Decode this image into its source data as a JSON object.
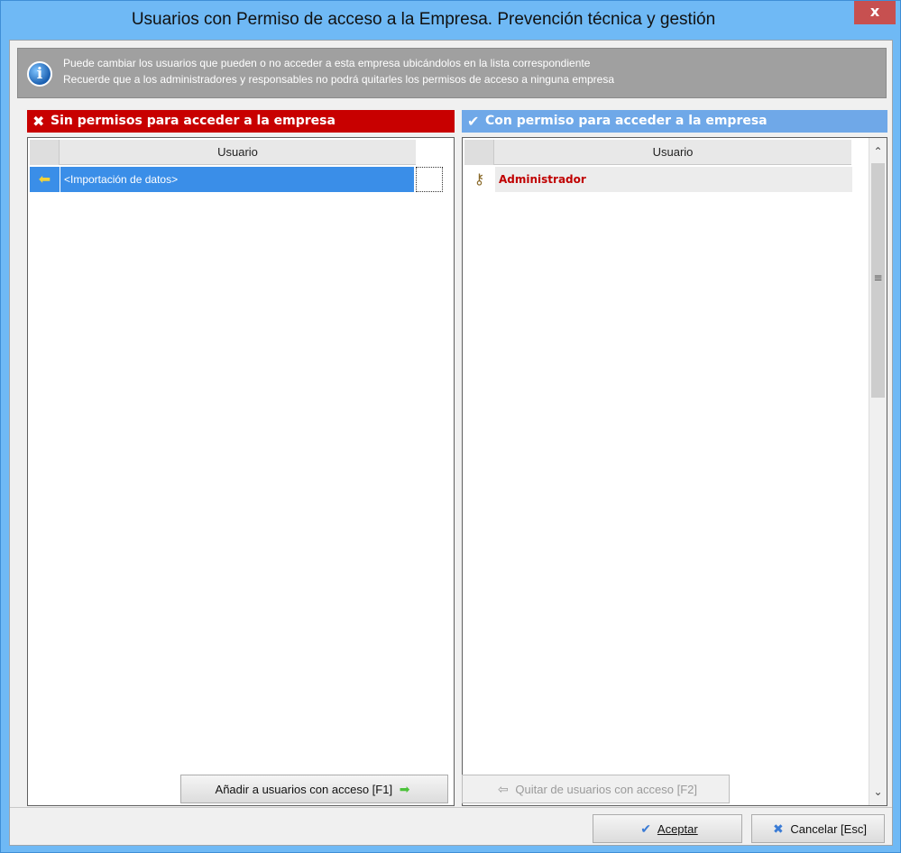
{
  "window": {
    "title": "Usuarios con Permiso de acceso a la Empresa. Prevención técnica y gestión",
    "close_label": "x"
  },
  "info": {
    "line1": "Puede cambiar los usuarios que pueden o no acceder a esta empresa ubicándolos en la lista correspondiente",
    "line2": "Recuerde que a los administradores y responsables  no podrá quitarles los permisos de acceso a ninguna empresa",
    "icon": "info-icon"
  },
  "left_panel": {
    "header": "Sin permisos para acceder a la empresa",
    "header_icon": "x-icon",
    "column": "Usuario",
    "rows": [
      {
        "label": "<Importación de datos>",
        "selected": true
      }
    ],
    "color": "#c80000"
  },
  "right_panel": {
    "header": "Con permiso para acceder a la empresa",
    "header_icon": "check-icon",
    "column": "Usuario",
    "rows": [
      {
        "label": "Administrador",
        "role_icon": "keys-icon"
      }
    ],
    "color": "#6fa8e8"
  },
  "buttons": {
    "add": "Añadir a usuarios con acceso  [F1]",
    "remove": "Quitar de usuarios con acceso  [F2]",
    "accept": "Aceptar",
    "cancel": "Cancelar  [Esc]"
  }
}
